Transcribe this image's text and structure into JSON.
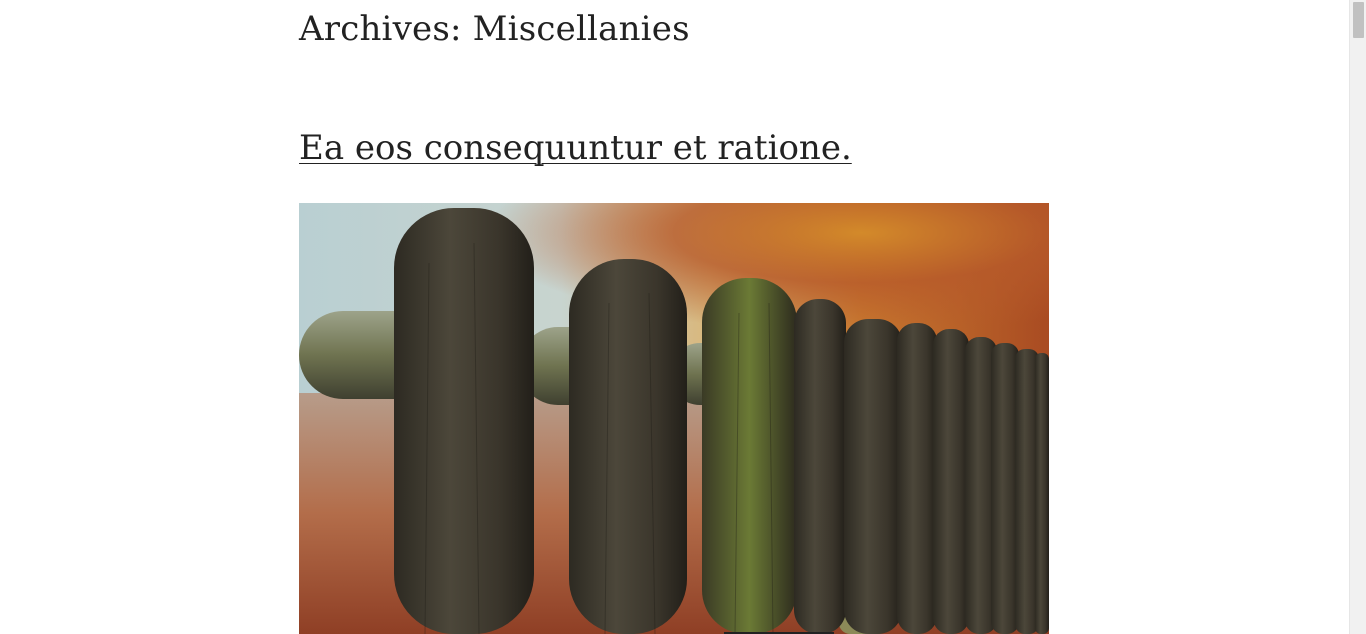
{
  "archive": {
    "title": "Archives: Miscellanies"
  },
  "post": {
    "title": "Ea eos consequuntur et ratione.",
    "image_icon": "fence-photo"
  },
  "colors": {
    "text": "#222222",
    "background": "#ffffff",
    "scrollbar_track": "#f1f1f1",
    "scrollbar_thumb": "#c1c1c1"
  }
}
